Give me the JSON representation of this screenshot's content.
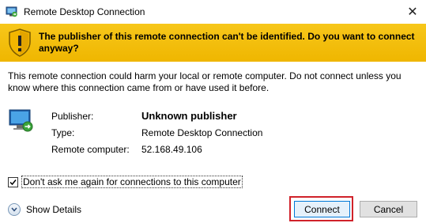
{
  "window": {
    "title": "Remote Desktop Connection",
    "close_label": "✕"
  },
  "warning": {
    "text": "The publisher of this remote connection can't be identified. Do you want to connect anyway?"
  },
  "body_text": "This remote connection could harm your local or remote computer. Do not connect unless you know where this connection came from or have used it before.",
  "details": {
    "publisher_label": "Publisher:",
    "publisher_value": "Unknown publisher",
    "type_label": "Type:",
    "type_value": "Remote Desktop Connection",
    "remote_label": "Remote computer:",
    "remote_value": "52.168.49.106"
  },
  "dont_ask": {
    "label": "Don't ask me again for connections to this computer",
    "checked": true
  },
  "show_details": "Show Details",
  "buttons": {
    "connect": "Connect",
    "cancel": "Cancel"
  },
  "colors": {
    "banner": "#f5c518",
    "highlight": "#d0222a",
    "default_button_border": "#0078d7"
  }
}
